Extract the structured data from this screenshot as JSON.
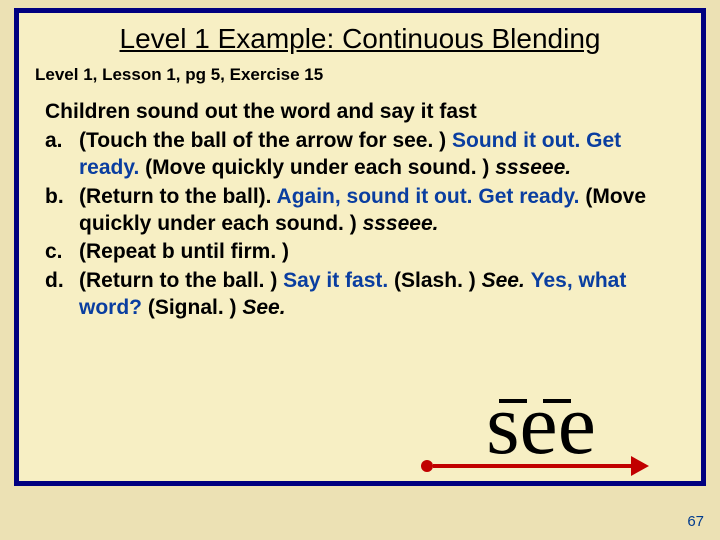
{
  "title": "Level 1 Example: Continuous Blending",
  "subtitle": "Level 1, Lesson 1, pg 5, Exercise 15",
  "lead": "Children sound out the word and say it fast",
  "items": {
    "a": {
      "marker": "a.",
      "p1": "(Touch the ball of the arrow for see. ) ",
      "b1": "Sound it out. Get ready. ",
      "p2": "(Move quickly under each sound. ) ",
      "i1": "ssseee."
    },
    "b": {
      "marker": "b.",
      "p1": "(Return to the ball). ",
      "b1": "Again, sound it out. Get ready. ",
      "p2": "(Move quickly under each sound. ) ",
      "i1": "ssseee."
    },
    "c": {
      "marker": "c.",
      "p1": "(Repeat b until firm. )"
    },
    "d": {
      "marker": "d.",
      "p1": "(Return to the ball. ) ",
      "b1": "Say it fast. ",
      "p2": "(Slash. ) ",
      "i1": "See. ",
      "b2": "Yes, what word? ",
      "p3": "(Signal. ) ",
      "i2": "See."
    }
  },
  "word": "see",
  "pagenum": "67"
}
